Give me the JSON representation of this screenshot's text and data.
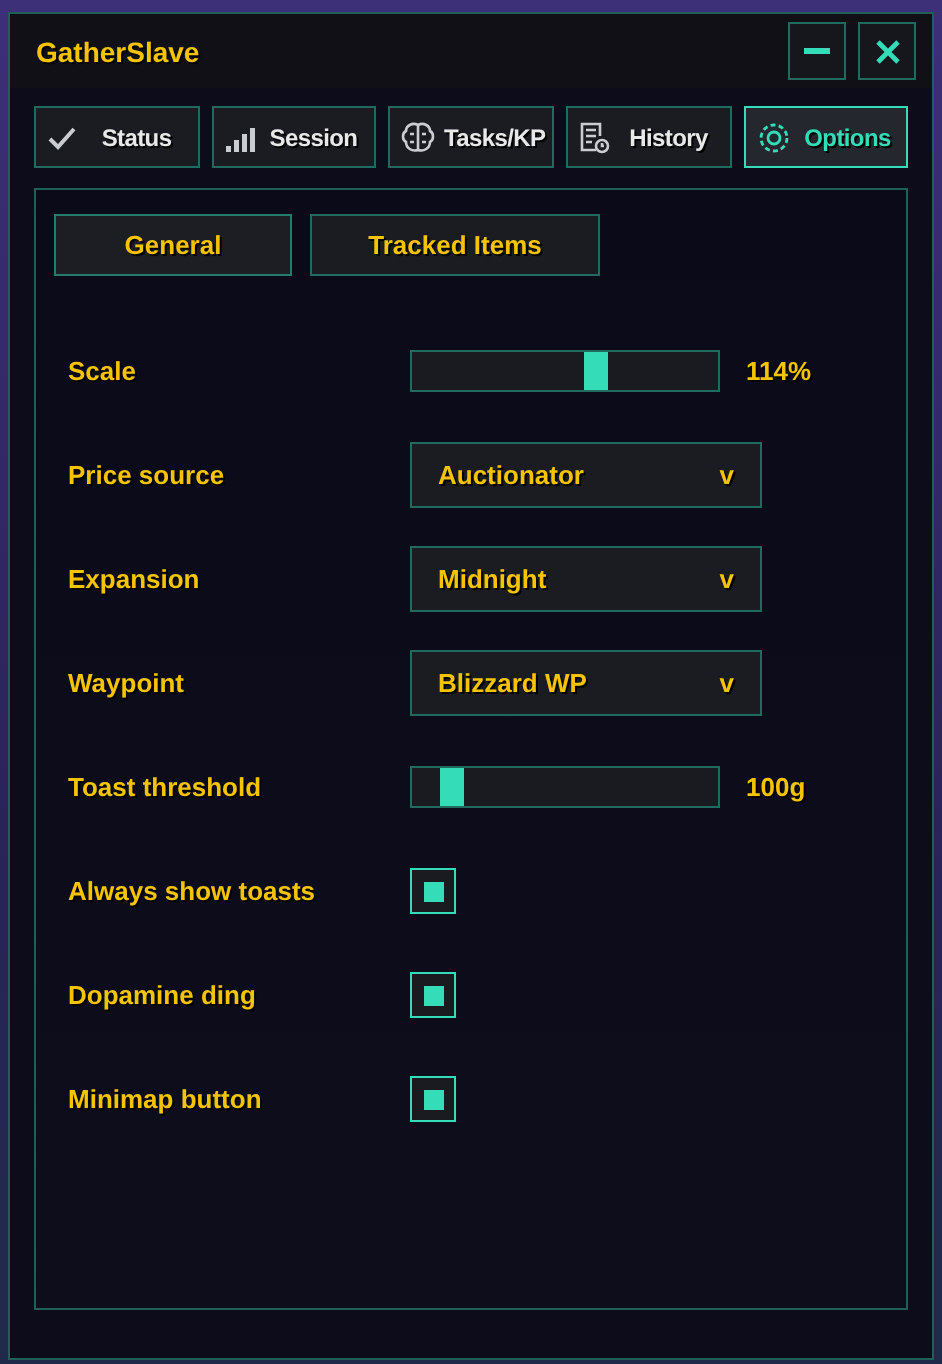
{
  "window": {
    "title": "GatherSlave"
  },
  "tabs": [
    {
      "label": "Status",
      "kind": "check",
      "selected": false
    },
    {
      "label": "Session",
      "kind": "bars",
      "selected": false
    },
    {
      "label": "Tasks/KP",
      "kind": "brain",
      "selected": false
    },
    {
      "label": "History",
      "kind": "doc",
      "selected": false
    },
    {
      "label": "Options",
      "kind": "gear",
      "selected": true
    }
  ],
  "subtabs": [
    {
      "label": "General",
      "selected": true
    },
    {
      "label": "Tracked Items",
      "selected": false
    }
  ],
  "settings": [
    {
      "kind": "slider",
      "label": "Scale",
      "level": 0.6,
      "reading": "114%"
    },
    {
      "kind": "dropdown",
      "label": "Price source",
      "value": "Auctionator",
      "caret": "v"
    },
    {
      "kind": "dropdown",
      "label": "Expansion",
      "value": "Midnight",
      "caret": "v"
    },
    {
      "kind": "dropdown",
      "label": "Waypoint",
      "value": "Blizzard WP",
      "caret": "v"
    },
    {
      "kind": "slider",
      "label": "Toast threshold",
      "level": 0.13,
      "reading": "100g"
    },
    {
      "kind": "checkbox",
      "label": "Always show toasts",
      "checked": true
    },
    {
      "kind": "checkbox",
      "label": "Dopamine ding",
      "checked": true
    },
    {
      "kind": "checkbox",
      "label": "Minimap button",
      "checked": true
    }
  ]
}
